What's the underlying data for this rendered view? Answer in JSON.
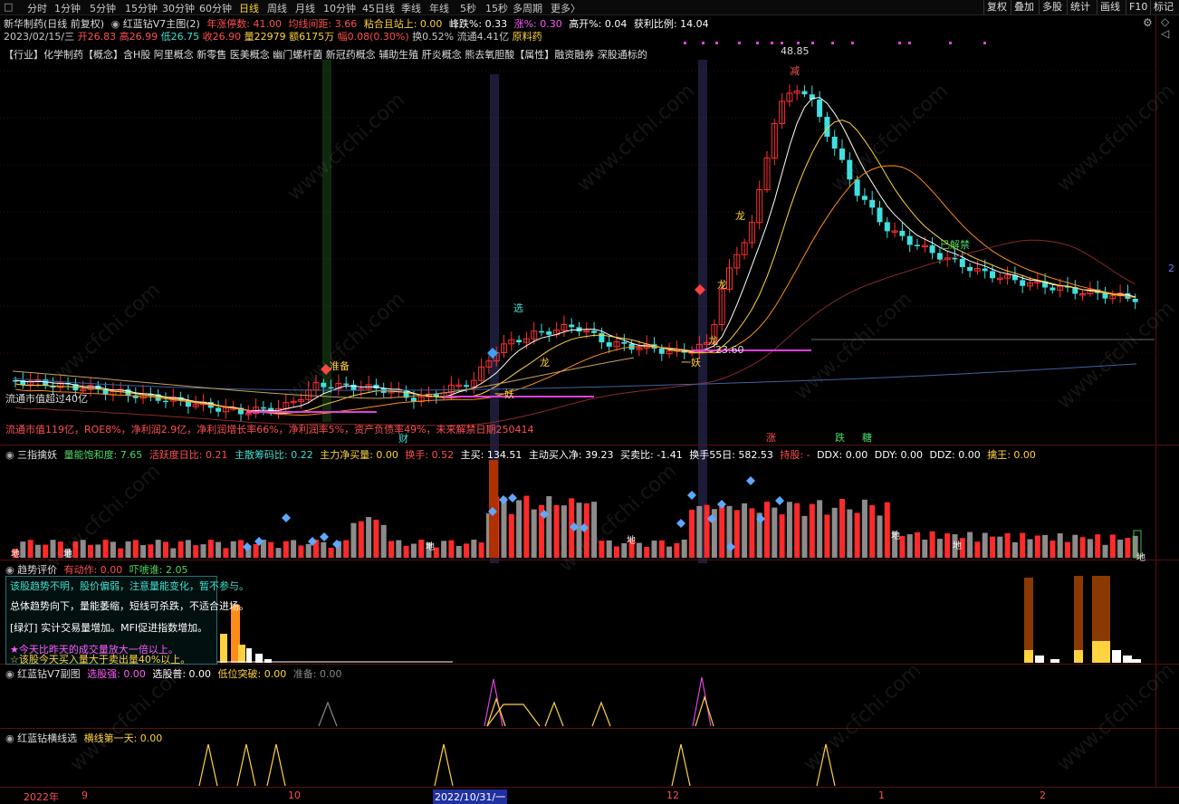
{
  "toolbar": {
    "logo": "□",
    "timeframes": [
      "分时",
      "1分钟",
      "5分钟",
      "15分钟",
      "30分钟",
      "60分钟",
      "日线",
      "周线",
      "月线",
      "10分钟",
      "45日线",
      "季线",
      "年线",
      "5秒",
      "15秒",
      "多周期",
      "更多〉"
    ],
    "active_timeframe": "日线",
    "right_buttons": [
      "复权",
      "叠加",
      "多股",
      "统计",
      "画线",
      "F10",
      "标记"
    ]
  },
  "main_header": {
    "stock": "新华制药(日线 前复权)",
    "indicator": "红蓝钻V7主图(2)",
    "items": [
      {
        "label": "年涨停数: 41.00",
        "color": "#ff5050"
      },
      {
        "label": "均线间距: 3.66",
        "color": "#ff5050"
      },
      {
        "label": "粘合且站上: 0.00",
        "color": "#ffd23f"
      },
      {
        "label": "峰跌%: 0.33",
        "color": "#ffffff"
      },
      {
        "label": "涨%: 0.30",
        "color": "#ff5cff"
      },
      {
        "label": "高开%: 0.04",
        "color": "#ffffff"
      },
      {
        "label": "获利比例: 14.04",
        "color": "#ffffff"
      }
    ],
    "info_line": [
      {
        "label": "2023/02/15/三",
        "color": "#c8c8c8"
      },
      {
        "label": "开26.83",
        "color": "#ff5050"
      },
      {
        "label": "高26.99",
        "color": "#ff5050"
      },
      {
        "label": "低26.75",
        "color": "#40e0d0"
      },
      {
        "label": "收26.90",
        "color": "#ff5050"
      },
      {
        "label": "量22979",
        "color": "#ffd23f"
      },
      {
        "label": "额6175万",
        "color": "#ffd23f"
      },
      {
        "label": "幅0.08(0.30%)",
        "color": "#ff5050"
      },
      {
        "label": "换0.52%",
        "color": "#c8c8c8"
      },
      {
        "label": "流通4.41亿",
        "color": "#c8c8c8"
      },
      {
        "label": "原料药",
        "color": "#ffd23f"
      }
    ],
    "concepts": "【行业】化学制药【概念】含H股 阿里概念 新零售 医美概念 幽门螺杆菌 新冠药概念 辅助生殖 肝炎概念 熊去氧胆酸【属性】融资融券 深股通标的"
  },
  "main_chart": {
    "peak_label": "48.85",
    "low_label": "23.60",
    "annotations": [
      {
        "text": "减",
        "color": "#ff5050"
      },
      {
        "text": "龙",
        "color": "#ffd23f"
      },
      {
        "text": "龙",
        "color": "#ffd23f"
      },
      {
        "text": "龙",
        "color": "#ffd23f"
      },
      {
        "text": "龙",
        "color": "#ffd23f"
      },
      {
        "text": "选",
        "color": "#40e0d0"
      },
      {
        "text": "准备",
        "color": "#ffd23f"
      },
      {
        "text": "一妖",
        "color": "#ffd23f"
      },
      {
        "text": "一妖",
        "color": "#ffd23f"
      },
      {
        "text": "已解禁",
        "color": "#4cd964"
      },
      {
        "text": "财",
        "color": "#40e0d0"
      },
      {
        "text": "涨",
        "color": "#ff5050"
      },
      {
        "text": "跌",
        "color": "#4cd964"
      },
      {
        "text": "糖",
        "color": "#4cd964"
      }
    ],
    "bottom_text_1": "流通市值超过40亿",
    "bottom_text_2": "流通市值119亿，ROE8%，净利润2.9亿，净利润增长率66%，净利润率5%，资产负债率49%，未来解禁日期250414",
    "right_tag": "2",
    "watermark": "www.cfchi.com"
  },
  "vol_header": {
    "name": "三指擒妖",
    "items": [
      {
        "label": "量能饱和度: 7.65",
        "color": "#4cd964"
      },
      {
        "label": "活跃度日比: 0.21",
        "color": "#ff5050"
      },
      {
        "label": "主散筹码比: 0.22",
        "color": "#40e0d0"
      },
      {
        "label": "主力净买量: 0.00",
        "color": "#ffd23f"
      },
      {
        "label": "换手: 0.52",
        "color": "#ff5050"
      },
      {
        "label": "主买: 134.51",
        "color": "#ffffff"
      },
      {
        "label": "主动买入净: 39.23",
        "color": "#ffffff"
      },
      {
        "label": "买卖比: -1.41",
        "color": "#ffffff"
      },
      {
        "label": "换手55日: 582.53",
        "color": "#ffffff"
      },
      {
        "label": "持股: -",
        "color": "#ff5050"
      },
      {
        "label": "DDX: 0.00",
        "color": "#ffffff"
      },
      {
        "label": "DDY: 0.00",
        "color": "#ffffff"
      },
      {
        "label": "DDZ: 0.00",
        "color": "#ffffff"
      },
      {
        "label": "擒王: 0.00",
        "color": "#ffd23f"
      }
    ],
    "di_label": "地"
  },
  "trend_header": {
    "name": "趋势评价",
    "items": [
      {
        "label": "有动作: 0.00",
        "color": "#ff5050"
      },
      {
        "label": "吓唬谁: 2.05",
        "color": "#4cd964"
      }
    ],
    "box": [
      {
        "text": "该股趋势不明，股价偏弱，注意量能变化，暂不参与。",
        "color": "#40e0d0"
      },
      {
        "text": "总体趋势向下，量能萎缩，短线可杀跌，不适合进场。",
        "color": "#ffffff"
      },
      {
        "text": "[绿灯] 实计交易量增加。MFI促进指数增加。",
        "color": "#ffffff"
      },
      {
        "text": "★今天比昨天的成交量放大一倍以上。",
        "color": "#ff5cff"
      },
      {
        "text": "☆该股今天买入量大于卖出量40%以上。",
        "color": "#ffd23f"
      }
    ]
  },
  "sub1_header": {
    "name": "红蓝钻V7副图",
    "items": [
      {
        "label": "选股强: 0.00",
        "color": "#ff5cff"
      },
      {
        "label": "选股普: 0.00",
        "color": "#ffffff"
      },
      {
        "label": "低位突破: 0.00",
        "color": "#ffd23f"
      },
      {
        "label": "准备: 0.00",
        "color": "#888888"
      }
    ]
  },
  "sub2_header": {
    "name": "红蓝钻横线选",
    "items": [
      {
        "label": "横线第一天: 0.00",
        "color": "#ffd23f"
      }
    ]
  },
  "x_axis": {
    "labels": [
      "2022年",
      "9",
      "10",
      "2022/10/31/一",
      "12",
      "1",
      "2"
    ]
  },
  "colors": {
    "up": "#ff3030",
    "down": "#40e0e0",
    "ma1": "#ffffff",
    "ma2": "#ffd23f",
    "ma3": "#ff8c1a",
    "ma4": "#c040c0",
    "ma5": "#4060a0"
  }
}
